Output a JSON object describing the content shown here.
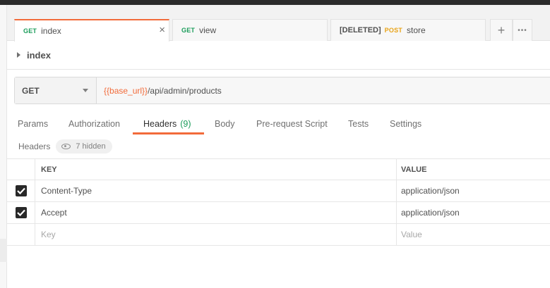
{
  "tabs": [
    {
      "method": "GET",
      "name": "index",
      "close": "×"
    },
    {
      "method": "GET",
      "name": "view"
    },
    {
      "prefix": "[DELETED]",
      "method": "POST",
      "name": "store"
    }
  ],
  "tab_actions": {
    "add": "+",
    "more": "•••"
  },
  "breadcrumb": {
    "title": "index"
  },
  "request": {
    "method": "GET",
    "url_variable": "{{base_url}}",
    "url_path": "/api/admin/products"
  },
  "request_tabs": {
    "params": "Params",
    "authorization": "Authorization",
    "headers": "Headers",
    "headers_count": "(9)",
    "body": "Body",
    "pre_request_script": "Pre-request Script",
    "tests": "Tests",
    "settings": "Settings"
  },
  "headers_section": {
    "label": "Headers",
    "hidden_label": "7 hidden"
  },
  "headers_table": {
    "key_header": "KEY",
    "value_header": "VALUE",
    "rows": [
      {
        "key": "Content-Type",
        "value": "application/json",
        "checked": true
      },
      {
        "key": "Accept",
        "value": "application/json",
        "checked": true
      }
    ],
    "new_row": {
      "key_placeholder": "Key",
      "value_placeholder": "Value"
    }
  },
  "colors": {
    "accent": "#f26b3a",
    "get_method": "#1a9c5a",
    "post_method": "#e8a317"
  }
}
